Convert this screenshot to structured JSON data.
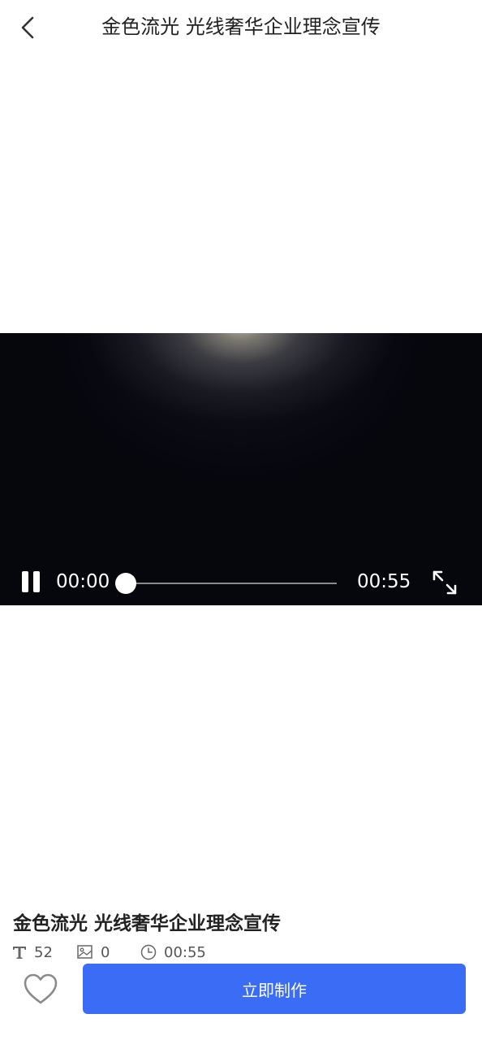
{
  "header": {
    "title": "金色流光 光线奢华企业理念宣传",
    "back_icon": "chevron-left-icon"
  },
  "video": {
    "current_time": "00:00",
    "total_time": "00:55",
    "progress_fraction": 0,
    "state": "playing",
    "pause_icon": "pause-icon",
    "fullscreen_icon": "fullscreen-icon"
  },
  "template": {
    "title": "金色流光 光线奢华企业理念宣传",
    "text_count": "52",
    "image_count": "0",
    "duration": "00:55"
  },
  "actions": {
    "like_icon": "heart-outline-icon",
    "make_label": "立即制作"
  },
  "colors": {
    "accent": "#3a6cf6",
    "video_bg": "#05050c",
    "text_primary": "#222222"
  }
}
